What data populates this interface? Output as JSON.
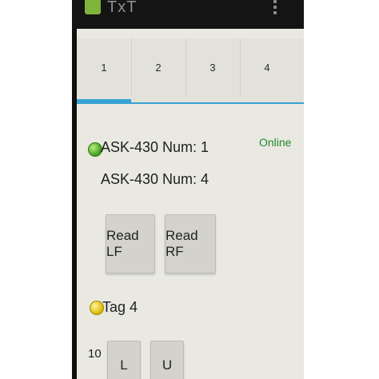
{
  "statusbar": {
    "app_title": "TxT"
  },
  "tabs": [
    {
      "label": "1",
      "selected": true
    },
    {
      "label": "2",
      "selected": false
    },
    {
      "label": "3",
      "selected": false
    },
    {
      "label": "4",
      "selected": false
    }
  ],
  "device": {
    "status_color": "#3c9b1c",
    "line1": "ASK-430 Num: 1",
    "line2": "ASK-430 Num: 4",
    "connection": "Online",
    "read_lf_label": "Read LF",
    "read_rf_label": "Read RF"
  },
  "tag": {
    "status_color": "#d9b800",
    "label": "Tag 4",
    "value": "10",
    "button1_label": "L",
    "button2_label": "U"
  },
  "colors": {
    "accent": "#36a3d3",
    "online_text": "#1f8a2a"
  }
}
